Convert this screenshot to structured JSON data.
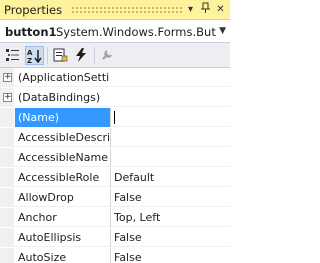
{
  "window": {
    "title": "Properties",
    "menu_icon": "dropdown-arrow-icon",
    "pin_icon": "pin-icon",
    "close_icon": "close-icon"
  },
  "object": {
    "name": "button1",
    "type": "System.Windows.Forms.Butto"
  },
  "toolbar": {
    "items": [
      "categorized-icon",
      "alphabetical-icon",
      "properties-icon",
      "events-icon",
      "property-pages-icon"
    ],
    "active": "alphabetical-icon"
  },
  "properties": [
    {
      "name": "(ApplicationSetti",
      "value": "",
      "expandable": true
    },
    {
      "name": "(DataBindings)",
      "value": "",
      "expandable": true
    },
    {
      "name": "(Name)",
      "value": "",
      "selected": true
    },
    {
      "name": "AccessibleDescri",
      "value": ""
    },
    {
      "name": "AccessibleName",
      "value": ""
    },
    {
      "name": "AccessibleRole",
      "value": "Default"
    },
    {
      "name": "AllowDrop",
      "value": "False"
    },
    {
      "name": "Anchor",
      "value": "Top, Left"
    },
    {
      "name": "AutoEllipsis",
      "value": "False"
    },
    {
      "name": "AutoSize",
      "value": "False"
    }
  ],
  "colors": {
    "titlebar": "#fff29d",
    "selection": "#3399ff"
  }
}
